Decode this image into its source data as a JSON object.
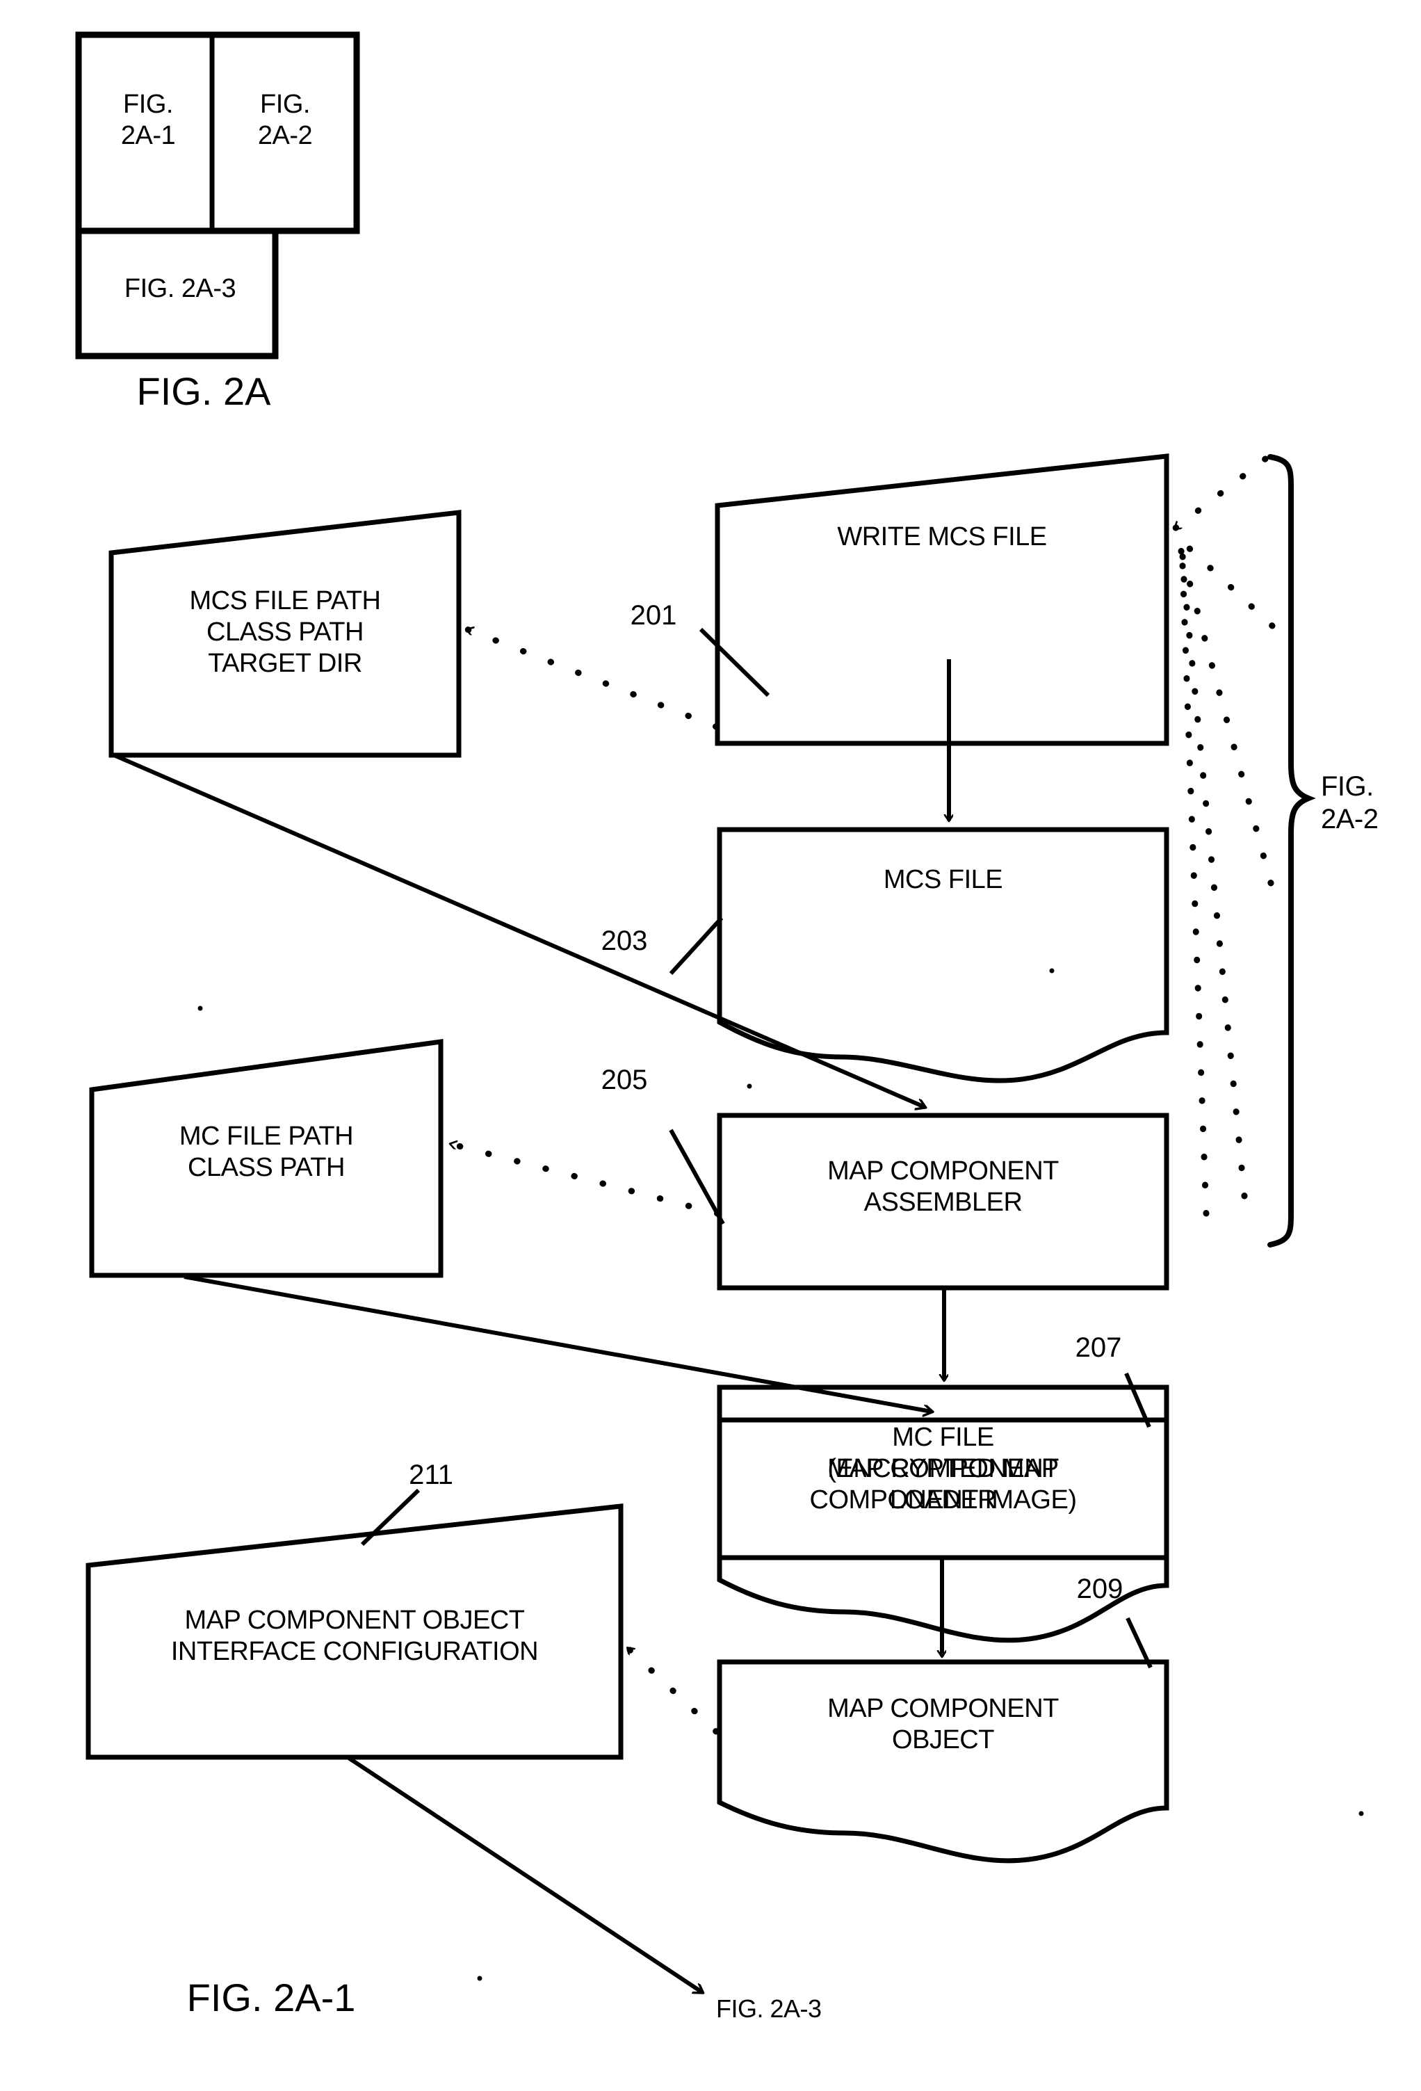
{
  "figure": {
    "title": "FIG. 2A",
    "sheet_label_left": "FIG. 2A-1",
    "bracket_label": "FIG.\n2A-2",
    "continuation_label": "FIG. 2A-3"
  },
  "key_map": {
    "cell_1": "FIG.\n2A-1",
    "cell_2": "FIG.\n2A-2",
    "cell_3": "FIG. 2A-3"
  },
  "nodes": {
    "write_mcs_file": {
      "label": "WRITE MCS FILE",
      "ref": ""
    },
    "mcs_file": {
      "label": "MCS FILE",
      "ref": "201"
    },
    "map_component_assembler": {
      "label": "MAP COMPONENT\nASSEMBLER",
      "ref": "203"
    },
    "mc_file": {
      "label": "MC FILE\n(ENCRYPTED MAP\nCOMPONENT IMAGE)",
      "ref": "205"
    },
    "map_component_loader": {
      "label": "MAP COMPONENT\nLOADER",
      "ref": "207"
    },
    "map_component_object": {
      "label": "MAP COMPONENT\nOBJECT",
      "ref": "209"
    }
  },
  "param_boxes": {
    "mcs_params": {
      "label": "MCS FILE PATH\nCLASS PATH\nTARGET DIR",
      "ref": ""
    },
    "mc_params": {
      "label": "MC FILE PATH\nCLASS PATH",
      "ref": ""
    },
    "mco_params": {
      "label": "MAP COMPONENT OBJECT\nINTERFACE CONFIGURATION",
      "ref": "211"
    }
  },
  "refs": {
    "r201": "201",
    "r203": "203",
    "r205": "205",
    "r207": "207",
    "r209": "209",
    "r211": "211"
  },
  "colors": {
    "ink": "#000000",
    "paper": "#ffffff"
  }
}
